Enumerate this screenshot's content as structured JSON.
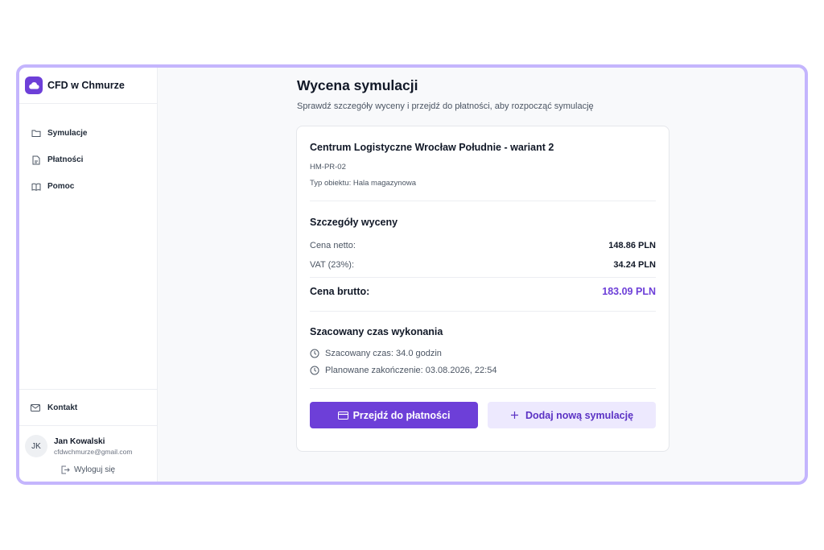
{
  "app": {
    "brand_name": "CFD w Chmurze"
  },
  "sidebar": {
    "items": [
      {
        "label": "Symulacje",
        "icon": "folder-icon"
      },
      {
        "label": "Płatności",
        "icon": "document-icon"
      },
      {
        "label": "Pomoc",
        "icon": "book-icon"
      }
    ],
    "contact_label": "Kontakt",
    "user": {
      "initials": "JK",
      "name": "Jan Kowalski",
      "email": "cfdwchmurze@gmail.com"
    },
    "logout_label": "Wyloguj się"
  },
  "page": {
    "title": "Wycena symulacji",
    "subtitle": "Sprawdź szczegóły wyceny i przejdź do płatności, aby rozpocząć symulację"
  },
  "object": {
    "name": "Centrum Logistyczne Wrocław Południe - wariant 2",
    "code": "HM-PR-02",
    "type": "Typ obiektu: Hala magazynowa"
  },
  "pricing": {
    "title": "Szczegóły wyceny",
    "net_label": "Cena netto:",
    "net_value": "148.86 PLN",
    "vat_label": "VAT (23%):",
    "vat_value": "34.24 PLN",
    "gross_label": "Cena brutto:",
    "gross_value": "183.09 PLN"
  },
  "estimate": {
    "title": "Szacowany czas wykonania",
    "duration": "Szacowany czas: 34.0 godzin",
    "completion": "Planowane zakończenie: 03.08.2026, 22:54"
  },
  "actions": {
    "pay_label": "Przejdź do płatności",
    "add_label": "Dodaj nową symulację"
  },
  "colors": {
    "accent": "#6d3fd8",
    "accent_light": "#ede9fe",
    "frame_border": "#c4b5fd"
  }
}
